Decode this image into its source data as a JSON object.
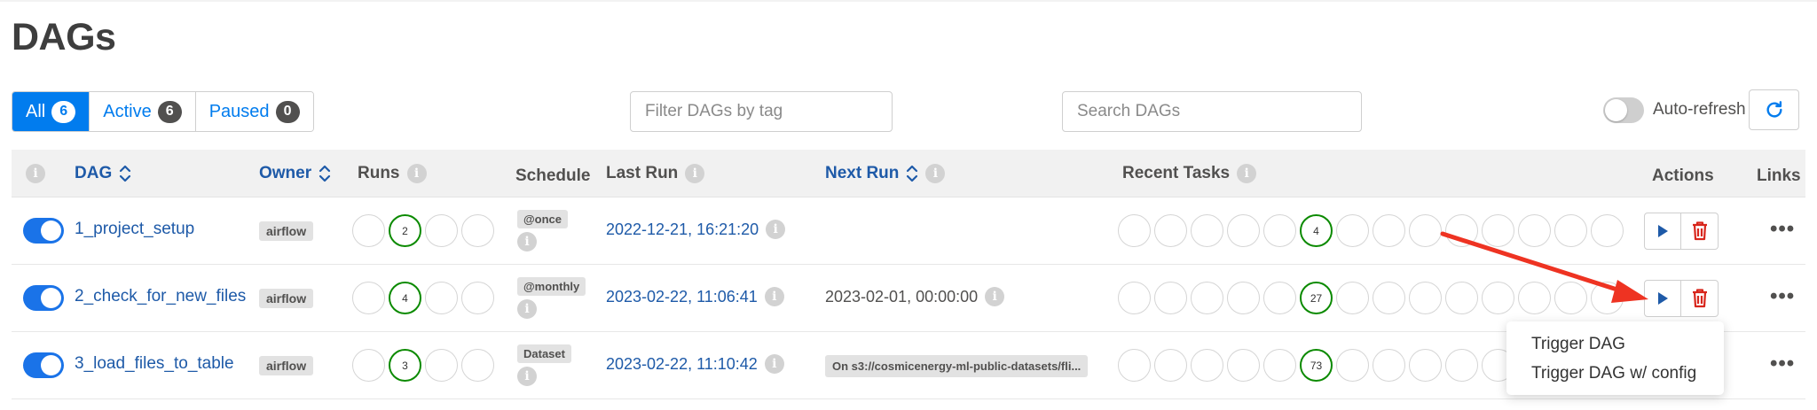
{
  "page": {
    "title": "DAGs"
  },
  "filters": {
    "all_label": "All",
    "all_count": "6",
    "active_label": "Active",
    "active_count": "6",
    "paused_label": "Paused",
    "paused_count": "0",
    "tag_placeholder": "Filter DAGs by tag",
    "search_placeholder": "Search DAGs",
    "autorefresh_label": "Auto-refresh"
  },
  "columns": {
    "info": "i",
    "dag": "DAG",
    "owner": "Owner",
    "runs": "Runs",
    "schedule": "Schedule",
    "last_run": "Last Run",
    "next_run": "Next Run",
    "recent_tasks": "Recent Tasks",
    "actions": "Actions",
    "links": "Links"
  },
  "rows": [
    {
      "dag_id": "1_project_setup",
      "owner": "airflow",
      "runs_success": "2",
      "schedule": "@once",
      "last_run": "2022-12-21, 16:21:20",
      "next_run": "",
      "recent_success": "4",
      "more": "•••"
    },
    {
      "dag_id": "2_check_for_new_files",
      "owner": "airflow",
      "runs_success": "4",
      "schedule": "@monthly",
      "last_run": "2023-02-22, 11:06:41",
      "next_run": "2023-02-01, 00:00:00",
      "recent_success": "27",
      "more": "•••"
    },
    {
      "dag_id": "3_load_files_to_table",
      "owner": "airflow",
      "runs_success": "3",
      "schedule": "Dataset",
      "last_run": "2023-02-22, 11:10:42",
      "next_run": "On s3://cosmicenergy-ml-public-datasets/fli...",
      "recent_success": "73",
      "more": "•••"
    }
  ],
  "dropdown": {
    "items": [
      "Trigger DAG",
      "Trigger DAG w/ config"
    ]
  },
  "colors": {
    "accent": "#017cee",
    "link": "#1e5aa8",
    "success": "#0b8a00",
    "delete": "#d8261c",
    "annotation_arrow": "#ee3322"
  },
  "icons": {
    "sort": "sort-updown-icon",
    "info": "info-icon",
    "refresh": "refresh-icon",
    "trigger": "play-icon",
    "delete": "trash-icon",
    "links": "more-horizontal-icon"
  }
}
